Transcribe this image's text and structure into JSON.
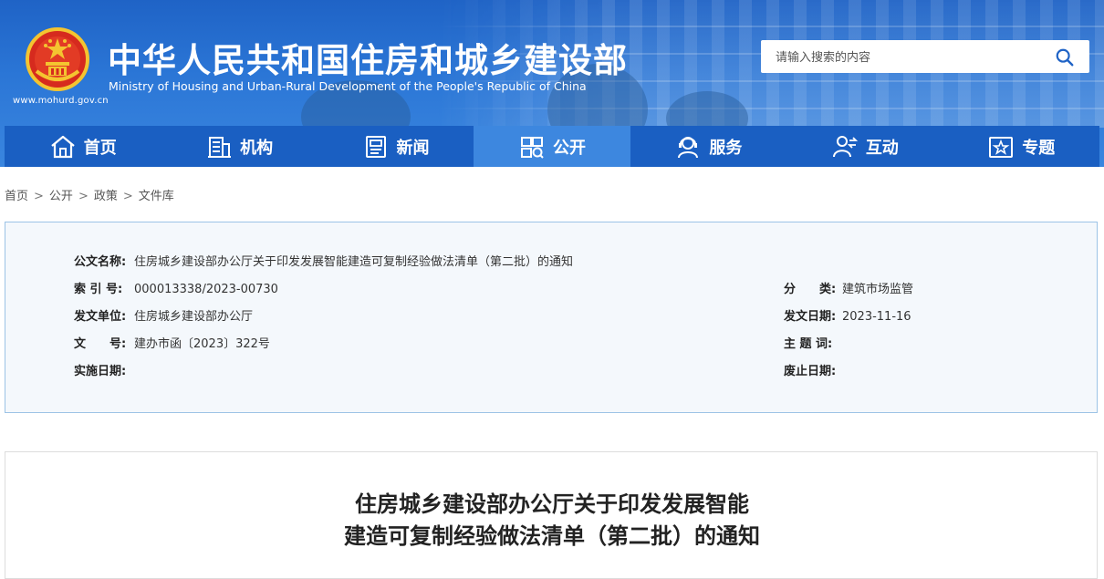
{
  "header": {
    "title": "中华人民共和国住房和城乡建设部",
    "subtitle": "Ministry of Housing and Urban-Rural Development of the People's Republic of China",
    "url": "www.mohurd.gov.cn",
    "search_placeholder": "请输入搜索的内容"
  },
  "nav": {
    "items": [
      {
        "label": "首页",
        "icon": "home-icon"
      },
      {
        "label": "机构",
        "icon": "building-icon"
      },
      {
        "label": "新闻",
        "icon": "news-icon"
      },
      {
        "label": "公开",
        "icon": "disclosure-icon",
        "active": true
      },
      {
        "label": "服务",
        "icon": "service-icon"
      },
      {
        "label": "互动",
        "icon": "interact-icon"
      },
      {
        "label": "专题",
        "icon": "topic-icon"
      }
    ]
  },
  "breadcrumb": [
    "首页",
    "公开",
    "政策",
    "文件库"
  ],
  "info": {
    "doc_name_label": "公文名称:",
    "doc_name": "住房城乡建设部办公厅关于印发发展智能建造可复制经验做法清单（第二批）的通知",
    "index_label": "索 引 号:",
    "index": "000013338/2023-00730",
    "category_label": "分　　类:",
    "category": "建筑市场监管",
    "issuer_label": "发文单位:",
    "issuer": "住房城乡建设部办公厅",
    "issue_date_label": "发文日期:",
    "issue_date": "2023-11-16",
    "doc_no_label": "文　　号:",
    "doc_no": "建办市函〔2023〕322号",
    "keywords_label": "主 题 词:",
    "keywords": "",
    "effective_label": "实施日期:",
    "effective": "",
    "abolish_label": "废止日期:",
    "abolish": ""
  },
  "article": {
    "title_line1": "住房城乡建设部办公厅关于印发发展智能",
    "title_line2": "建造可复制经验做法清单（第二批）的通知"
  },
  "colors": {
    "header_blue": "#1f63c6",
    "nav_blue": "#1a5fc2",
    "nav_active": "#3d87df",
    "info_bg": "#f4f8fc",
    "info_border": "#9cc3e6"
  }
}
